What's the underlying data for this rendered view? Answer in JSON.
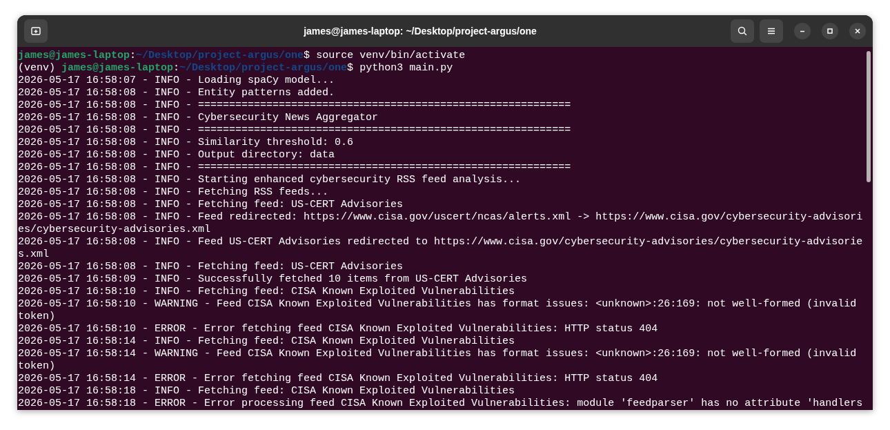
{
  "window": {
    "title": "james@james-laptop: ~/Desktop/project-argus/one"
  },
  "lines": [
    {
      "kind": "prompt",
      "user": "james@james-laptop",
      "separator": ":",
      "path": "~/Desktop/project-argus/one",
      "symbol": "$",
      "command": "source venv/bin/activate"
    },
    {
      "kind": "prompt",
      "prefix": "(venv)",
      "user": "james@james-laptop",
      "separator": ":",
      "path": "~/Desktop/project-argus/one",
      "symbol": "$",
      "command": "python3 main.py"
    },
    {
      "kind": "log",
      "text": "2026-05-17 16:58:07 - INFO - Loading spaCy model..."
    },
    {
      "kind": "log",
      "text": "2026-05-17 16:58:08 - INFO - Entity patterns added."
    },
    {
      "kind": "log",
      "text": "2026-05-17 16:58:08 - INFO - ============================================================"
    },
    {
      "kind": "log",
      "text": "2026-05-17 16:58:08 - INFO - Cybersecurity News Aggregator"
    },
    {
      "kind": "log",
      "text": "2026-05-17 16:58:08 - INFO - ============================================================"
    },
    {
      "kind": "log",
      "text": "2026-05-17 16:58:08 - INFO - Similarity threshold: 0.6"
    },
    {
      "kind": "log",
      "text": "2026-05-17 16:58:08 - INFO - Output directory: data"
    },
    {
      "kind": "log",
      "text": "2026-05-17 16:58:08 - INFO - ============================================================"
    },
    {
      "kind": "log",
      "text": "2026-05-17 16:58:08 - INFO - Starting enhanced cybersecurity RSS feed analysis..."
    },
    {
      "kind": "log",
      "text": "2026-05-17 16:58:08 - INFO - Fetching RSS feeds..."
    },
    {
      "kind": "log",
      "text": "2026-05-17 16:58:08 - INFO - Fetching feed: US-CERT Advisories"
    },
    {
      "kind": "log",
      "text": "2026-05-17 16:58:08 - INFO - Feed redirected: https://www.cisa.gov/uscert/ncas/alerts.xml -> https://www.cisa.gov/cybersecurity-advisories/cybersecurity-advisories.xml"
    },
    {
      "kind": "log",
      "text": "2026-05-17 16:58:08 - INFO - Feed US-CERT Advisories redirected to https://www.cisa.gov/cybersecurity-advisories/cybersecurity-advisories.xml"
    },
    {
      "kind": "log",
      "text": "2026-05-17 16:58:08 - INFO - Fetching feed: US-CERT Advisories"
    },
    {
      "kind": "log",
      "text": "2026-05-17 16:58:09 - INFO - Successfully fetched 10 items from US-CERT Advisories"
    },
    {
      "kind": "log",
      "text": "2026-05-17 16:58:10 - INFO - Fetching feed: CISA Known Exploited Vulnerabilities"
    },
    {
      "kind": "log",
      "text": "2026-05-17 16:58:10 - WARNING - Feed CISA Known Exploited Vulnerabilities has format issues: <unknown>:26:169: not well-formed (invalid token)"
    },
    {
      "kind": "log",
      "text": "2026-05-17 16:58:10 - ERROR - Error fetching feed CISA Known Exploited Vulnerabilities: HTTP status 404"
    },
    {
      "kind": "log",
      "text": "2026-05-17 16:58:14 - INFO - Fetching feed: CISA Known Exploited Vulnerabilities"
    },
    {
      "kind": "log",
      "text": "2026-05-17 16:58:14 - WARNING - Feed CISA Known Exploited Vulnerabilities has format issues: <unknown>:26:169: not well-formed (invalid token)"
    },
    {
      "kind": "log",
      "text": "2026-05-17 16:58:14 - ERROR - Error fetching feed CISA Known Exploited Vulnerabilities: HTTP status 404"
    },
    {
      "kind": "log",
      "text": "2026-05-17 16:58:18 - INFO - Fetching feed: CISA Known Exploited Vulnerabilities"
    },
    {
      "kind": "log",
      "text": "2026-05-17 16:58:18 - ERROR - Error processing feed CISA Known Exploited Vulnerabilities: module 'feedparser' has no attribute 'handlers"
    }
  ]
}
